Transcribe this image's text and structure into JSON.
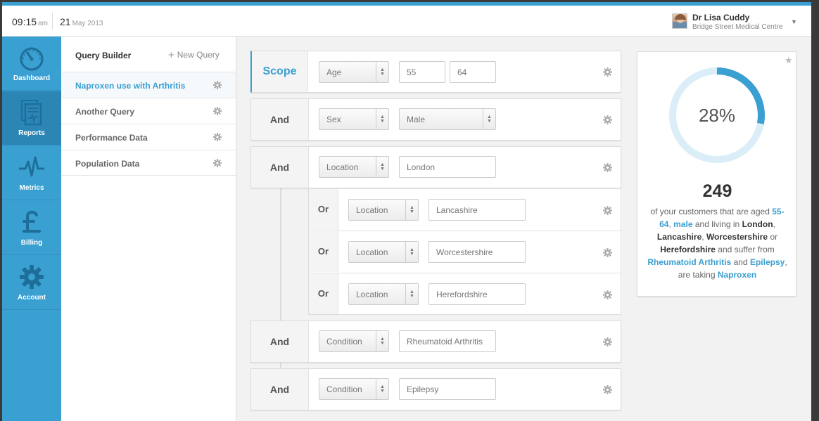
{
  "header": {
    "time": "09:15",
    "ampm": "am",
    "day": "21",
    "month_year": "May 2013",
    "user_name": "Dr Lisa Cuddy",
    "user_org": "Bridge Street Medical Centre"
  },
  "sidebar": {
    "items": [
      {
        "label": "Dashboard",
        "icon": "dashboard-icon",
        "active": false
      },
      {
        "label": "Reports",
        "icon": "reports-icon",
        "active": true
      },
      {
        "label": "Metrics",
        "icon": "metrics-icon",
        "active": false
      },
      {
        "label": "Billing",
        "icon": "pound-icon",
        "active": false
      },
      {
        "label": "Account",
        "icon": "gear-icon",
        "active": false
      }
    ]
  },
  "query_panel": {
    "title": "Query Builder",
    "new_query": "New Query",
    "items": [
      {
        "label": "Naproxen use with Arthritis",
        "active": true
      },
      {
        "label": "Another Query",
        "active": false
      },
      {
        "label": "Performance Data",
        "active": false
      },
      {
        "label": "Population Data",
        "active": false
      }
    ]
  },
  "builder": {
    "rows": [
      {
        "connector": "Scope",
        "field": "Age",
        "value1": "55",
        "value2": "64"
      },
      {
        "connector": "And",
        "field": "Sex",
        "value": "Male"
      },
      {
        "connector": "And",
        "field": "Location",
        "value": "London"
      },
      {
        "connector": "Or",
        "field": "Location",
        "value": "Lancashire"
      },
      {
        "connector": "Or",
        "field": "Location",
        "value": "Worcestershire"
      },
      {
        "connector": "Or",
        "field": "Location",
        "value": "Herefordshire"
      },
      {
        "connector": "And",
        "field": "Condition",
        "value": "Rheumatoid Arthritis"
      },
      {
        "connector": "And",
        "field": "Condition",
        "value": "Epilepsy"
      }
    ]
  },
  "stats": {
    "percent": "28%",
    "percent_value": 0.28,
    "count": "249",
    "desc": {
      "t1": "of your customers that are aged",
      "age": "55-64",
      "c1": ",",
      "sex": "male",
      "t2": "and living in",
      "loc1": "London",
      "c2": ",",
      "loc2": "Lancashire",
      "c3": ",",
      "loc3": "Worcestershire",
      "t3": "or",
      "loc4": "Herefordshire",
      "t4": "and suffer from",
      "cond1": "Rheumatoid Arthritis",
      "t5": "and",
      "cond2": "Epilepsy",
      "t6": ", are taking",
      "drug": "Naproxen"
    }
  },
  "colors": {
    "accent": "#3a9fd1",
    "ring_track": "#dbeef8"
  }
}
